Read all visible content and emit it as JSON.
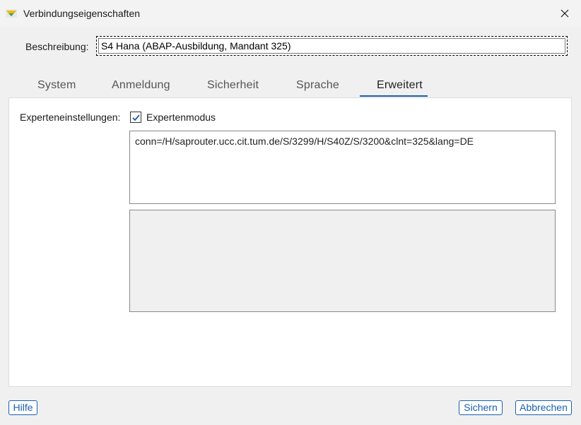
{
  "window": {
    "title": "Verbindungseigenschaften",
    "app_icon": "sap-logon-icon",
    "close_icon": "close-icon"
  },
  "description": {
    "label": "Beschreibung:",
    "value": "S4 Hana (ABAP-Ausbildung, Mandant 325)"
  },
  "tabs": [
    {
      "label": "System",
      "active": false
    },
    {
      "label": "Anmeldung",
      "active": false
    },
    {
      "label": "Sicherheit",
      "active": false
    },
    {
      "label": "Sprache",
      "active": false
    },
    {
      "label": "Erweitert",
      "active": true
    }
  ],
  "advanced": {
    "expert_settings_label": "Experteneinstellungen:",
    "expert_mode_label": "Expertenmodus",
    "expert_mode_checked": true,
    "connection_string": "conn=/H/saprouter.ucc.cit.tum.de/S/3299/H/S40Z/S/3200&clnt=325&lang=DE"
  },
  "buttons": {
    "help": "Hilfe",
    "save": "Sichern",
    "cancel": "Abbrechen"
  },
  "colors": {
    "accent": "#1a5fb4",
    "background": "#f0f0f0",
    "panel": "#ffffff"
  }
}
